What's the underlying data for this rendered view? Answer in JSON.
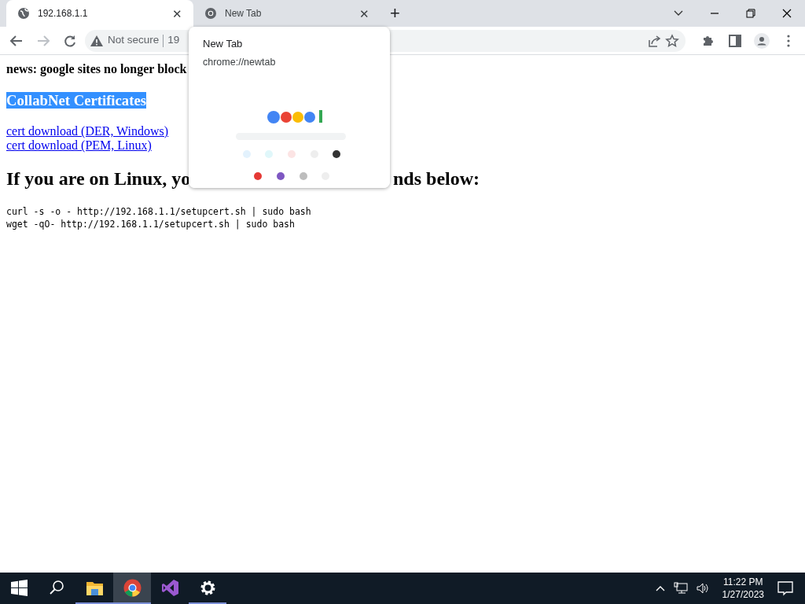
{
  "tabs": [
    {
      "title": "192.168.1.1",
      "kind": "globe",
      "selected": true
    },
    {
      "title": "New Tab",
      "kind": "chrome",
      "selected": false
    }
  ],
  "address_bar": {
    "security": "Not secure",
    "url": "19"
  },
  "tab_close_glyph": "✕",
  "new_tab_glyph": "+",
  "hover_card": {
    "title": "New Tab",
    "url": "chrome://newtab"
  },
  "page": {
    "news": "news: google sites no longer block",
    "selected_heading": "CollabNet Certificates",
    "links": [
      "cert download (DER, Windows)",
      "cert download (PEM, Linux)"
    ],
    "heading_start": "If you are on Linux, yo",
    "heading_end": "nds below:",
    "commands": [
      "curl -s -o - http://192.168.1.1/setupcert.sh | sudo bash",
      "wget -qO- http://192.168.1.1/setupcert.sh | sudo bash"
    ]
  },
  "taskbar": {
    "apps": [
      {
        "kind": "start",
        "open": false,
        "selected": false
      },
      {
        "kind": "search",
        "open": false,
        "selected": false
      },
      {
        "kind": "folder",
        "open": true,
        "selected": false
      },
      {
        "kind": "chrome",
        "open": true,
        "selected": true
      },
      {
        "kind": "vs",
        "open": false,
        "selected": false
      },
      {
        "kind": "gear",
        "open": true,
        "selected": false
      }
    ],
    "time": "11:22 PM",
    "date": "1/27/2023"
  }
}
